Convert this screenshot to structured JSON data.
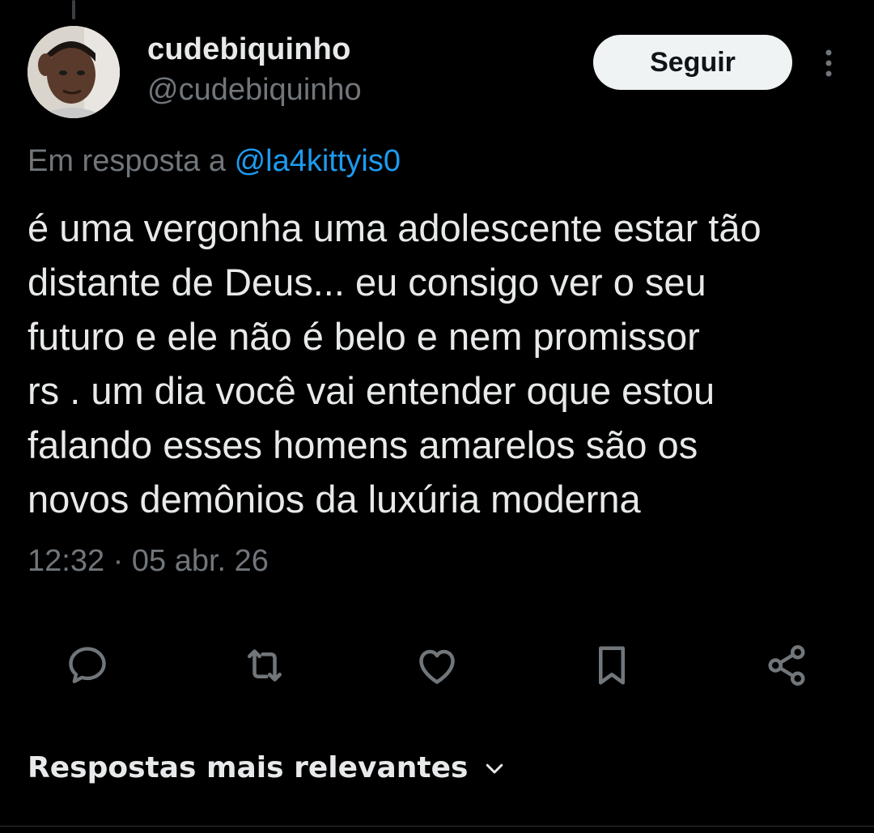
{
  "author": {
    "display_name": "cudebiquinho",
    "handle": "@cudebiquinho",
    "avatar_icon": "user-avatar"
  },
  "follow_label": "Seguir",
  "more_icon": "more-vertical-icon",
  "reply_context": {
    "prefix": "Em resposta a ",
    "mention": "@la4kittyis0"
  },
  "tweet": {
    "text": "é uma vergonha uma adolescente estar tão\ndistante de Deus... eu consigo ver o seu\nfuturo e ele não é belo e nem promissor\nrs .  um dia você vai entender oque estou\nfalando esses homens amarelos são os\nnovos demônios da luxúria moderna",
    "timestamp": "12:32 · 05 abr. 26"
  },
  "actions": [
    {
      "name": "reply",
      "icon": "reply-icon"
    },
    {
      "name": "retweet",
      "icon": "retweet-icon"
    },
    {
      "name": "like",
      "icon": "heart-icon"
    },
    {
      "name": "bookmark",
      "icon": "bookmark-icon"
    },
    {
      "name": "share",
      "icon": "share-icon"
    }
  ],
  "replies_sort": {
    "label": "Respostas mais relevantes",
    "icon": "chevron-down-icon"
  },
  "colors": {
    "background": "#000000",
    "text": "#e7e9ea",
    "secondary": "#71767b",
    "link": "#1d9bf0",
    "button_bg": "#eff3f4"
  }
}
